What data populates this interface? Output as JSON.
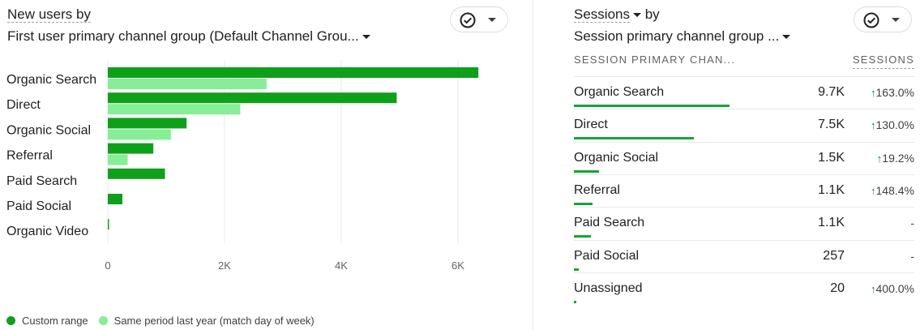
{
  "left_card": {
    "title_line1": "New users by",
    "title_line2": "First user primary channel group (Default Channel Grou...",
    "legend": [
      {
        "label": "Custom range",
        "color": "#0fa01a"
      },
      {
        "label": "Same period last year (match day of week)",
        "color": "#86ee96"
      }
    ]
  },
  "right_card": {
    "title_line1": "Sessions",
    "title_line1_suffix": "by",
    "title_line2": "Session primary channel group ...",
    "col_label": "SESSION PRIMARY CHAN...",
    "col_value": "SESSIONS",
    "rows": [
      {
        "label": "Organic Search",
        "value": "9.7K",
        "change": "163.0%",
        "up": true,
        "share": 1.0
      },
      {
        "label": "Direct",
        "value": "7.5K",
        "change": "130.0%",
        "up": true,
        "share": 0.77
      },
      {
        "label": "Organic Social",
        "value": "1.5K",
        "change": "19.2%",
        "up": true,
        "share": 0.16
      },
      {
        "label": "Referral",
        "value": "1.1K",
        "change": "148.4%",
        "up": true,
        "share": 0.12
      },
      {
        "label": "Paid Search",
        "value": "1.1K",
        "change": "-",
        "up": false,
        "share": 0.11
      },
      {
        "label": "Paid Social",
        "value": "257",
        "change": "-",
        "up": false,
        "share": 0.03
      },
      {
        "label": "Unassigned",
        "value": "20",
        "change": "400.0%",
        "up": true,
        "share": 0.01
      }
    ]
  },
  "chart_data": {
    "type": "bar",
    "orientation": "horizontal",
    "categories": [
      "Organic Search",
      "Direct",
      "Organic Social",
      "Referral",
      "Paid Search",
      "Paid Social",
      "Organic Video"
    ],
    "series": [
      {
        "name": "Custom range",
        "values": [
          6350,
          4950,
          1350,
          780,
          980,
          250,
          15
        ],
        "color": "#0fa01a"
      },
      {
        "name": "Same period last year (match day of week)",
        "values": [
          2720,
          2270,
          1080,
          340,
          0,
          0,
          0
        ],
        "color": "#86ee96"
      }
    ],
    "xticks": [
      "0",
      "2K",
      "4K",
      "6K"
    ],
    "xtick_values": [
      0,
      2000,
      4000,
      6000
    ],
    "xlim": [
      0,
      6600
    ],
    "grid": true,
    "legend_position": "bottom-left"
  }
}
